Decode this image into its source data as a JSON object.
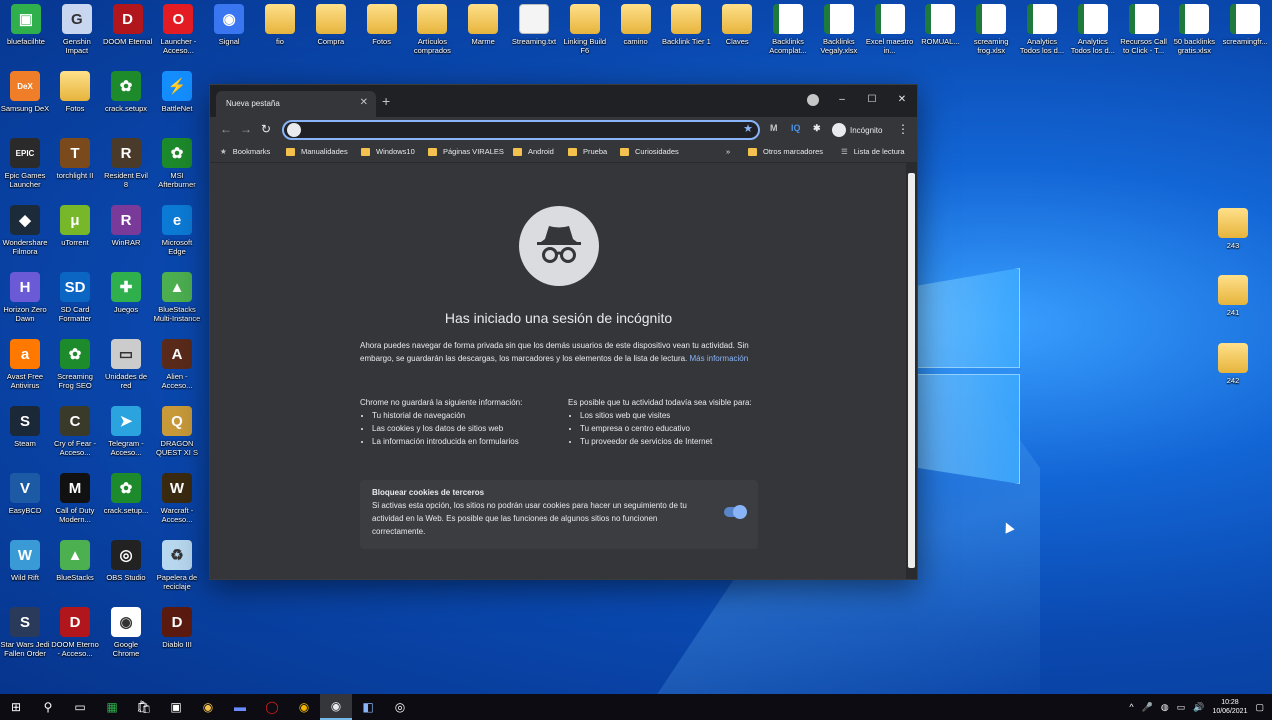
{
  "desktop": {
    "icons": [
      {
        "label": "bluefacilhte",
        "kind": "app",
        "color": "#2fb04c",
        "glyph": "▣"
      },
      {
        "label": "Genshin Impact",
        "kind": "app",
        "color": "#c9d6f0",
        "glyph": "G"
      },
      {
        "label": "DOOM Eternal",
        "kind": "app",
        "color": "#b0161b",
        "glyph": "D"
      },
      {
        "label": "Launcher - Acceso...",
        "kind": "app",
        "color": "#e31b23",
        "glyph": "O"
      },
      {
        "label": "Signal",
        "kind": "app",
        "color": "#3a76f0",
        "glyph": "◉"
      },
      {
        "label": "fio",
        "kind": "folder"
      },
      {
        "label": "Compra",
        "kind": "folder"
      },
      {
        "label": "Fotos",
        "kind": "folder"
      },
      {
        "label": "Artículos comprados",
        "kind": "folder"
      },
      {
        "label": "Marme",
        "kind": "folder"
      },
      {
        "label": "Streaming.txt",
        "kind": "doc"
      },
      {
        "label": "Linking Build F6",
        "kind": "folder"
      },
      {
        "label": "camino",
        "kind": "folder"
      },
      {
        "label": "Backlink Tier 1",
        "kind": "folder"
      },
      {
        "label": "Claves",
        "kind": "folder"
      },
      {
        "label": "Backlinks Acomplat...",
        "kind": "sheet"
      },
      {
        "label": "Backlinks Vegaly.xlsx",
        "kind": "sheet"
      },
      {
        "label": "Excel maestro in...",
        "kind": "sheet"
      },
      {
        "label": "ROMUAL...",
        "kind": "sheet"
      },
      {
        "label": "screaming frog.xlsx",
        "kind": "sheet"
      },
      {
        "label": "Analytics Todos los d...",
        "kind": "sheet"
      },
      {
        "label": "Analytics Todos los d...",
        "kind": "sheet"
      },
      {
        "label": "Recursos Call to Click - T...",
        "kind": "sheet"
      },
      {
        "label": "50 backlinks gratis.xlsx",
        "kind": "sheet"
      },
      {
        "label": "screamingfr...",
        "kind": "sheet"
      },
      {
        "label": "Samsung DeX",
        "kind": "app",
        "color": "#f07d28",
        "glyph": "DeX"
      },
      {
        "label": "Fotos",
        "kind": "folder"
      },
      {
        "label": "crack.setupx",
        "kind": "app",
        "color": "#1d8a2b",
        "glyph": "✿"
      },
      {
        "label": "BattleNet",
        "kind": "app",
        "color": "#148eff",
        "glyph": "⚡"
      },
      {
        "label": "Epic Games Launcher",
        "kind": "app",
        "color": "#2a2a2a",
        "glyph": "EPIC"
      },
      {
        "label": "torchlight II",
        "kind": "app",
        "color": "#7a4a1c",
        "glyph": "T"
      },
      {
        "label": "Resident Evil 8",
        "kind": "app",
        "color": "#4a3a2a",
        "glyph": "R"
      },
      {
        "label": "MSI Afterburner",
        "kind": "app",
        "color": "#1d8a2b",
        "glyph": "✿"
      },
      {
        "label": "Wondershare Filmora",
        "kind": "app",
        "color": "#1c2b3a",
        "glyph": "◆"
      },
      {
        "label": "uTorrent",
        "kind": "app",
        "color": "#76b82a",
        "glyph": "μ"
      },
      {
        "label": "WinRAR",
        "kind": "app",
        "color": "#7a3a9a",
        "glyph": "R"
      },
      {
        "label": "Microsoft Edge",
        "kind": "app",
        "color": "#0c7bd6",
        "glyph": "e"
      },
      {
        "label": "Horizon Zero Dawn",
        "kind": "app",
        "color": "#6a5ad6",
        "glyph": "H"
      },
      {
        "label": "SD Card Formatter",
        "kind": "app",
        "color": "#0a66c2",
        "glyph": "SD"
      },
      {
        "label": "Juegos",
        "kind": "app",
        "color": "#2fb04c",
        "glyph": "✚"
      },
      {
        "label": "BlueStacks Multi-Instance",
        "kind": "app",
        "color": "#4caf50",
        "glyph": "▲"
      },
      {
        "label": "Avast Free Antivirus",
        "kind": "app",
        "color": "#ff7800",
        "glyph": "a"
      },
      {
        "label": "Screaming Frog SEO",
        "kind": "app",
        "color": "#1d8a2b",
        "glyph": "✿"
      },
      {
        "label": "Unidades de red",
        "kind": "app",
        "color": "#cccccc",
        "glyph": "▭"
      },
      {
        "label": "Alien - Acceso...",
        "kind": "app",
        "color": "#5a2a1a",
        "glyph": "A"
      },
      {
        "label": "Steam",
        "kind": "app",
        "color": "#1b2838",
        "glyph": "S"
      },
      {
        "label": "Cry of Fear - Acceso...",
        "kind": "app",
        "color": "#3a3a2a",
        "glyph": "C"
      },
      {
        "label": "Telegram - Acceso...",
        "kind": "app",
        "color": "#2aa3df",
        "glyph": "➤"
      },
      {
        "label": "DRAGON QUEST XI S",
        "kind": "app",
        "color": "#c89a3a",
        "glyph": "Q"
      },
      {
        "label": "EasyBCD",
        "kind": "app",
        "color": "#1c5aa6",
        "glyph": "V"
      },
      {
        "label": "Call of Duty Modern...",
        "kind": "app",
        "color": "#111111",
        "glyph": "M"
      },
      {
        "label": "crack.setup...",
        "kind": "app",
        "color": "#1d8a2b",
        "glyph": "✿"
      },
      {
        "label": "Warcraft - Acceso...",
        "kind": "app",
        "color": "#3a2a10",
        "glyph": "W"
      },
      {
        "label": "Wild Rift",
        "kind": "app",
        "color": "#3a9ad6",
        "glyph": "W"
      },
      {
        "label": "BlueStacks",
        "kind": "app",
        "color": "#4caf50",
        "glyph": "▲"
      },
      {
        "label": "OBS Studio",
        "kind": "app",
        "color": "#222222",
        "glyph": "◎"
      },
      {
        "label": "Papelera de reciclaje",
        "kind": "app",
        "color": "#b8d8f0",
        "glyph": "♻"
      },
      {
        "label": "Star Wars Jedi Fallen Order",
        "kind": "app",
        "color": "#2a3a5a",
        "glyph": "S"
      },
      {
        "label": "DOOM Eterno - Acceso...",
        "kind": "app",
        "color": "#b0161b",
        "glyph": "D"
      },
      {
        "label": "Google Chrome",
        "kind": "app",
        "color": "#ffffff",
        "glyph": "◉"
      },
      {
        "label": "Diablo III",
        "kind": "app",
        "color": "#5a1a10",
        "glyph": "D"
      },
      {
        "label": "243",
        "kind": "folder"
      },
      {
        "label": "241",
        "kind": "folder"
      },
      {
        "label": "242",
        "kind": "folder"
      }
    ]
  },
  "browser": {
    "tab_title": "Nueva pestaña",
    "tab_close": "✕",
    "new_tab": "+",
    "controls": {
      "minimize": "–",
      "maximize": "☐",
      "close": "✕"
    },
    "nav": {
      "back": "←",
      "forward": "→",
      "reload": "↻"
    },
    "omnibox_value": "",
    "star": "★",
    "extensions": [
      "M",
      "IQ",
      "✱"
    ],
    "incognito_label": "Incógnito",
    "menu": "⋮",
    "bookmarks": [
      "Bookmarks",
      "Manualidades",
      "Windows10",
      "Páginas VIRALES",
      "Android",
      "Prueba",
      "Curiosidades"
    ],
    "bookmarks_overflow": "»",
    "other_bookmarks": "Otros marcadores",
    "reading_list": "Lista de lectura",
    "heading": "Has iniciado una sesión de incógnito",
    "intro": "Ahora puedes navegar de forma privada sin que los demás usuarios de este dispositivo vean tu actividad. Sin embargo, se guardarán las descargas, los marcadores y los elementos de la lista de lectura.",
    "more_info": "Más información",
    "left_col": {
      "title": "Chrome no guardará la siguiente información:",
      "items": [
        "Tu historial de navegación",
        "Las cookies y los datos de sitios web",
        "La información introducida en formularios"
      ]
    },
    "right_col": {
      "title": "Es posible que tu actividad todavía sea visible para:",
      "items": [
        "Los sitios web que visites",
        "Tu empresa o centro educativo",
        "Tu proveedor de servicios de Internet"
      ]
    },
    "cookie": {
      "title": "Bloquear cookies de terceros",
      "desc": "Si activas esta opción, los sitios no podrán usar cookies para hacer un seguimiento de tu actividad en la Web. Es posible que las funciones de algunos sitios no funcionen correctamente.",
      "enabled": true
    }
  },
  "taskbar": {
    "clock_time": "10:28",
    "clock_date": "10/06/2021"
  }
}
